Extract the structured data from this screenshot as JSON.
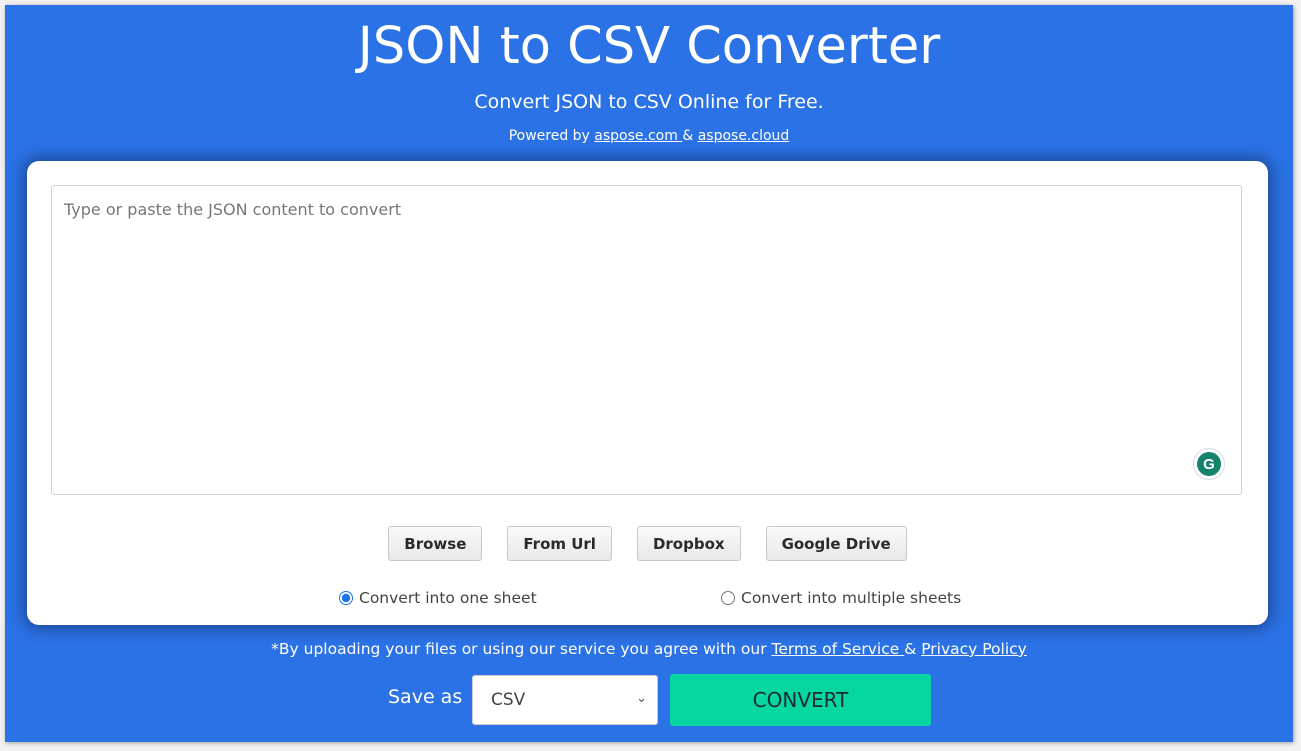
{
  "header": {
    "title": "JSON to CSV Converter",
    "subtitle": "Convert JSON to CSV Online for Free.",
    "powered_by_prefix": "Powered by ",
    "powered_by_link1": "aspose.com ",
    "powered_by_separator": "& ",
    "powered_by_link2": "aspose.cloud"
  },
  "editor": {
    "value": "",
    "placeholder": "Type or paste the JSON content to convert",
    "grammarly_icon": "grammarly-g-icon",
    "grammarly_glyph": "G"
  },
  "sources": [
    {
      "label": "Browse"
    },
    {
      "label": "From Url"
    },
    {
      "label": "Dropbox"
    },
    {
      "label": "Google Drive"
    }
  ],
  "options": {
    "one_sheet": {
      "label": "Convert into one sheet",
      "checked": true
    },
    "multiple_sheets": {
      "label": "Convert into multiple sheets",
      "checked": false
    }
  },
  "terms": {
    "prefix": "*By uploading your files or using our service you agree with our ",
    "terms_link": "Terms of Service ",
    "separator": "& ",
    "privacy_link": "Privacy Policy"
  },
  "save": {
    "label": "Save as",
    "selected_format": "CSV",
    "chevron": "⌄",
    "convert_label": "CONVERT"
  },
  "colors": {
    "background": "#2b72e6",
    "convert_button": "#06d6a0",
    "radio_accent": "#1a73e8",
    "grammarly": "#15826b"
  }
}
